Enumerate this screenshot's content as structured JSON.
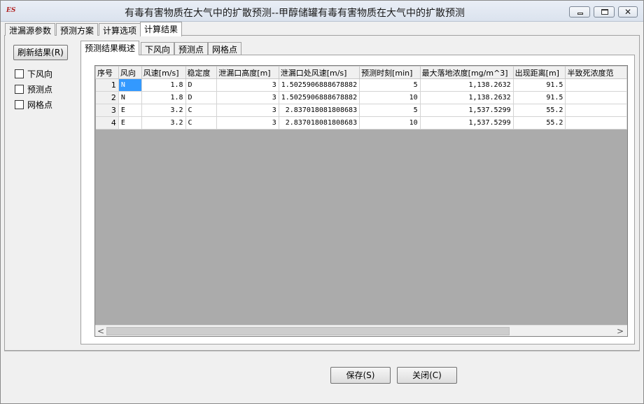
{
  "window": {
    "title": "有毒有害物质在大气中的扩散预测--甲醇储罐有毒有害物质在大气中的扩散预测",
    "minimize_glyph": "",
    "maximize_glyph": "",
    "close_glyph": "✕",
    "app_icon_text": "ES"
  },
  "top_tabs": [
    {
      "label": "泄漏源参数"
    },
    {
      "label": "预测方案"
    },
    {
      "label": "计算选项"
    },
    {
      "label": "计算结果"
    }
  ],
  "left_panel": {
    "refresh_label": "刷新结果(R)",
    "checkboxes": [
      {
        "label": "下风向",
        "checked": false
      },
      {
        "label": "预测点",
        "checked": false
      },
      {
        "label": "网格点",
        "checked": false
      }
    ]
  },
  "inner_tabs": [
    {
      "label": "预测结果概述"
    },
    {
      "label": "下风向"
    },
    {
      "label": "预测点"
    },
    {
      "label": "网格点"
    }
  ],
  "table": {
    "columns": [
      "序号",
      "风向",
      "风速[m/s]",
      "稳定度",
      "泄漏口高度[m]",
      "泄漏口处风速[m/s]",
      "预测时刻[min]",
      "最大落地浓度[mg/m^3]",
      "出现距离[m]",
      "半致死浓度范"
    ],
    "rows": [
      [
        "1",
        "N",
        "1.8",
        "D",
        "3",
        "1.5025906888678882",
        "5",
        "1,138.2632",
        "91.5",
        ""
      ],
      [
        "2",
        "N",
        "1.8",
        "D",
        "3",
        "1.5025906888678882",
        "10",
        "1,138.2632",
        "91.5",
        ""
      ],
      [
        "3",
        "E",
        "3.2",
        "C",
        "3",
        "2.837018081808683",
        "5",
        "1,537.5299",
        "55.2",
        ""
      ],
      [
        "4",
        "E",
        "3.2",
        "C",
        "3",
        "2.837018081808683",
        "10",
        "1,537.5299",
        "55.2",
        ""
      ]
    ],
    "selected_cell": "1,风向"
  },
  "scrollbar": {
    "left_arrow": "<",
    "right_arrow": ">"
  },
  "footer": {
    "save_label": "保存(S)",
    "close_label": "关闭(C)"
  },
  "colors": {
    "selection": "#3399ff",
    "grid_empty": "#ababab"
  }
}
